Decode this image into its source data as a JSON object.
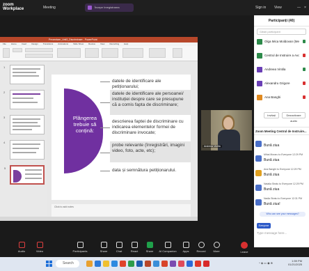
{
  "zoom": {
    "logo_line1": "zoom",
    "logo_line2": "Workplace",
    "meeting_label": "Meeting",
    "recording_label": "Începe înregistrarea"
  },
  "topbar_right": {
    "signin": "Sign in",
    "view": "View"
  },
  "powerpoint": {
    "window_title": "Prezentare_Unit3_Discriminare - PowerPoint",
    "tabs": [
      "File",
      "Home",
      "Insert",
      "Design",
      "Transitions",
      "Animations",
      "Slide Show",
      "Review",
      "View",
      "Recording",
      "Help"
    ],
    "notes_placeholder": "Click to add notes",
    "thumb_numbers": [
      "1",
      "2",
      "3",
      "4",
      "5"
    ]
  },
  "slide": {
    "main_line1": "Plângerea",
    "main_line2": "trebuie să",
    "main_line3": "conțină:",
    "items": [
      "datele de identificare ale petiționarului;",
      "datele de identificare ale persoanei/ instituției despre care se presupune că a comis fapta de discriminare;",
      "descrierea faptei de discriminare cu indicarea elementelor formei de discriminare invocate;",
      "probe relevante (înregistrări, imagini video, foto, acte, etc);",
      "data și semnătura petiționarului."
    ]
  },
  "video": {
    "name": "Andreea Vintila"
  },
  "participants_panel": {
    "title": "Participanți (40)",
    "search_placeholder": "Găsiți participant",
    "participants": [
      {
        "name": "Olga Mica Moldovan (Me)",
        "color": "#2d8a4a"
      },
      {
        "name": "Centrul de Instruire a Avo... (Host)",
        "color": "#2d8a4a"
      },
      {
        "name": "Andreea Vintila",
        "color": "#6a3fb5"
      },
      {
        "name": "Alexandru Grigore",
        "color": "#6a3fb5"
      },
      {
        "name": "Ana Banghi",
        "color": "#e08a20"
      }
    ],
    "invite_label": "Invitați",
    "mute_all_label": "Dezactivare audio",
    "chat_title": "Zoom Meeting Centrul de Instruire..."
  },
  "chat": {
    "messages": [
      {
        "from": "",
        "text": "Bună ziua",
        "color": "#4a6fc8"
      },
      {
        "from": "Mihai Moraru to Everyone 12:29 PM",
        "text": "Bună ziua",
        "color": "#4a6fc8"
      },
      {
        "from": "Ana Banghi to Everyone 12:29 PM",
        "text": "Bună ziua",
        "color": "#e0a020"
      },
      {
        "from": "Natalia Stratu to Everyone 12:29 PM",
        "text": "Bună ziua",
        "color": "#4a6fc8"
      },
      {
        "from": "Nadia Stratu to Everyone 12:31 PM",
        "text": "Bună ziua!",
        "color": "#4a6fc8"
      }
    ],
    "who_can_see": "Who can see your messages?",
    "to_label": "Everyone",
    "input_placeholder": "Type message here..."
  },
  "toolbar": {
    "items": [
      "Audio",
      "Video",
      "Participants",
      "Share",
      "Chat",
      "React",
      "Share",
      "AI Companion",
      "Apps",
      "Record",
      "More"
    ],
    "participant_count": "40",
    "leave": "Leave"
  },
  "taskbar": {
    "search": "Search",
    "time": "1:59 PM",
    "date": "01/21/2025"
  }
}
